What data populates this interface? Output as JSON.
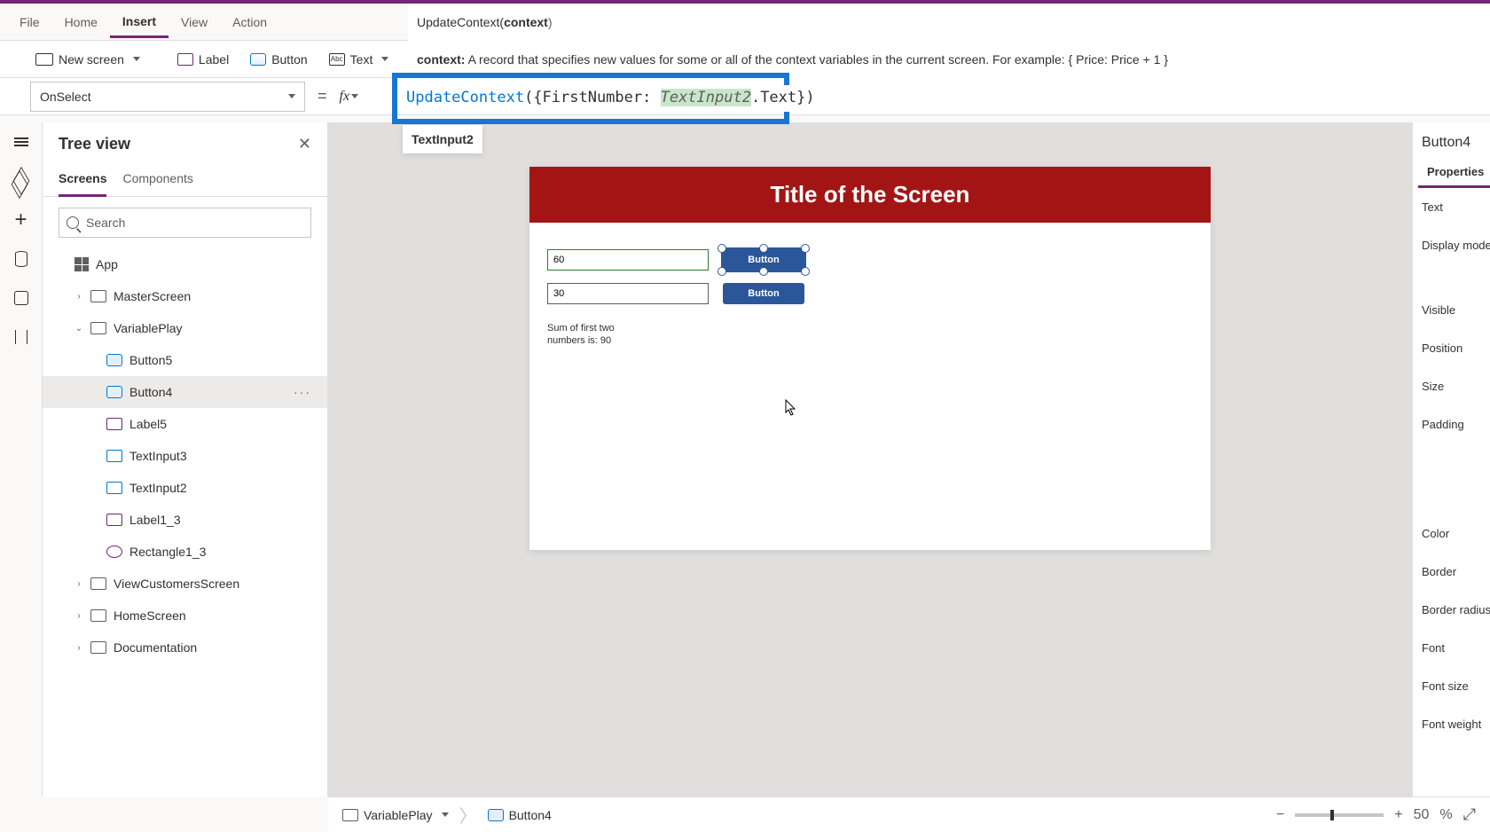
{
  "menus": {
    "file": "File",
    "home": "Home",
    "insert": "Insert",
    "view": "View",
    "action": "Action"
  },
  "formula_ctx": {
    "fn": "UpdateContext(",
    "param": "context",
    "close": ")"
  },
  "context_help": {
    "label": "context:",
    "desc": " A record that specifies new values for some or all of the context variables in the current screen. For example: { Price: Price + 1 }"
  },
  "ribbon": {
    "new_screen": "New screen",
    "label": "Label",
    "button": "Button",
    "text": "Text"
  },
  "prop_select": "OnSelect",
  "fx_label": "fx",
  "formula": {
    "fn": "UpdateContext",
    "open": "({FirstNumber: ",
    "ref": "TextInput2",
    "tail": ".Text})"
  },
  "autocomplete": "TextInput2",
  "tree": {
    "title": "Tree view",
    "tabs": {
      "screens": "Screens",
      "components": "Components"
    },
    "search_ph": "Search",
    "items": [
      {
        "name": "App",
        "type": "app"
      },
      {
        "name": "MasterScreen",
        "type": "screen",
        "arrow": "›"
      },
      {
        "name": "VariablePlay",
        "type": "screen",
        "arrow": "⌄",
        "expanded": true
      },
      {
        "name": "Button5",
        "type": "btn",
        "child": true
      },
      {
        "name": "Button4",
        "type": "btn",
        "child": true,
        "selected": true,
        "more": true
      },
      {
        "name": "Label5",
        "type": "lbl",
        "child": true
      },
      {
        "name": "TextInput3",
        "type": "txt",
        "child": true
      },
      {
        "name": "TextInput2",
        "type": "txt",
        "child": true
      },
      {
        "name": "Label1_3",
        "type": "lbl",
        "child": true
      },
      {
        "name": "Rectangle1_3",
        "type": "rect",
        "child": true
      },
      {
        "name": "ViewCustomersScreen",
        "type": "screen",
        "arrow": "›"
      },
      {
        "name": "HomeScreen",
        "type": "screen",
        "arrow": "›"
      },
      {
        "name": "Documentation",
        "type": "screen",
        "arrow": "›"
      }
    ]
  },
  "canvas": {
    "title": "Title of the Screen",
    "input1": "60",
    "input2": "30",
    "button": "Button",
    "sum_label": "Sum of first two numbers is: 90"
  },
  "right_panel": {
    "title": "Button4",
    "tab": "Properties",
    "props": [
      "Text",
      "Display mode",
      "Visible",
      "Position",
      "Size",
      "Padding",
      "Color",
      "Border",
      "Border radius",
      "Font",
      "Font size",
      "Font weight"
    ]
  },
  "status": {
    "screen": "VariablePlay",
    "control": "Button4",
    "zoom": "50",
    "pct": "%"
  }
}
